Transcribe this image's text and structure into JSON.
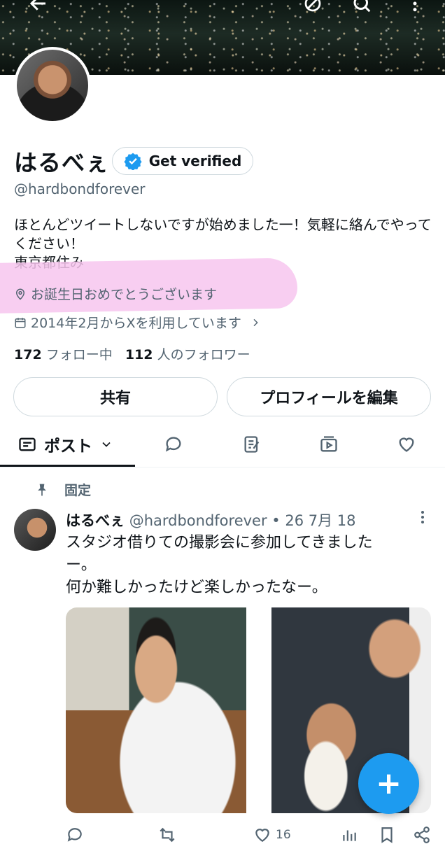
{
  "profile": {
    "display_name": "はるべぇ",
    "verify_label": "Get verified",
    "handle": "@hardbondforever",
    "bio": "ほとんどツイートしないですが始めました一！気軽に絡んでやってください！\n東京都住み",
    "location": "お誕生日おめでとうございます",
    "joined": "2014年2月からXを利用しています",
    "following_count": "172",
    "following_label": "フォロー中",
    "followers_count": "112",
    "followers_label": "人のフォロワー",
    "share_label": "共有",
    "edit_label": "プロフィールを編集",
    "accent_color": "#1d9bf0",
    "highlight_color": "#f7c6ef"
  },
  "tabs": {
    "posts_label": "ポスト",
    "icons": [
      "posts-icon",
      "replies-icon",
      "articles-icon",
      "media-icon",
      "likes-icon"
    ]
  },
  "tweet": {
    "pinned_label": "固定",
    "author_name": "はるべぇ",
    "author_handle": "@hardbondforever",
    "dot": "•",
    "date": "26 7月 18",
    "text": "スタジオ借りての撮影会に参加してきました\nー。\n何か難しかったけど楽しかったなー。",
    "like_count": "16"
  },
  "fab": {
    "label": "+"
  }
}
